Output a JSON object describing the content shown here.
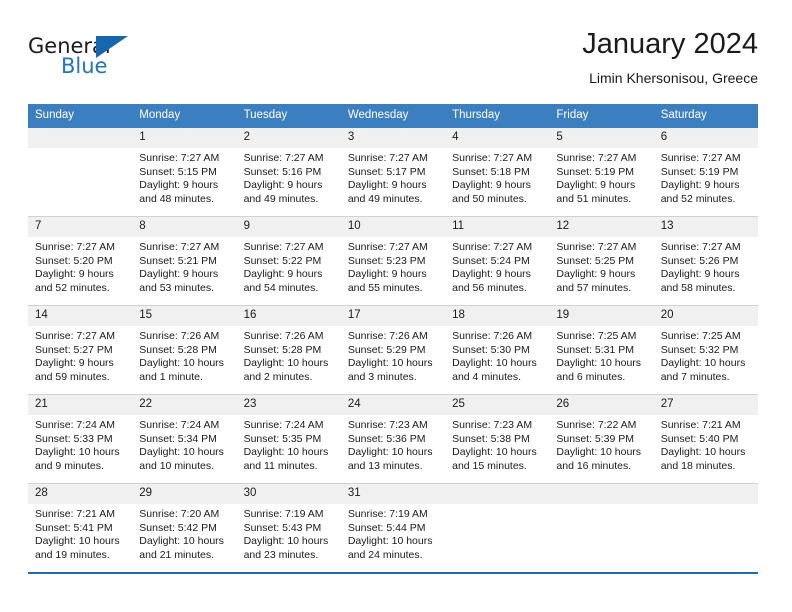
{
  "logo": {
    "word1": "General",
    "word2": "Blue",
    "triangle_color": "#1667ae",
    "blue_text_color": "#2175bc"
  },
  "header": {
    "title": "January 2024",
    "subtitle": "Limin Khersonisou, Greece"
  },
  "calendar": {
    "header_bg": "#3c7fc0",
    "daynum_bg": "#f0f0f0",
    "weekdays": [
      "Sunday",
      "Monday",
      "Tuesday",
      "Wednesday",
      "Thursday",
      "Friday",
      "Saturday"
    ],
    "weeks": [
      [
        {
          "day": "",
          "sunrise": "",
          "sunset": "",
          "daylight": ""
        },
        {
          "day": "1",
          "sunrise": "Sunrise: 7:27 AM",
          "sunset": "Sunset: 5:15 PM",
          "daylight": "Daylight: 9 hours and 48 minutes."
        },
        {
          "day": "2",
          "sunrise": "Sunrise: 7:27 AM",
          "sunset": "Sunset: 5:16 PM",
          "daylight": "Daylight: 9 hours and 49 minutes."
        },
        {
          "day": "3",
          "sunrise": "Sunrise: 7:27 AM",
          "sunset": "Sunset: 5:17 PM",
          "daylight": "Daylight: 9 hours and 49 minutes."
        },
        {
          "day": "4",
          "sunrise": "Sunrise: 7:27 AM",
          "sunset": "Sunset: 5:18 PM",
          "daylight": "Daylight: 9 hours and 50 minutes."
        },
        {
          "day": "5",
          "sunrise": "Sunrise: 7:27 AM",
          "sunset": "Sunset: 5:19 PM",
          "daylight": "Daylight: 9 hours and 51 minutes."
        },
        {
          "day": "6",
          "sunrise": "Sunrise: 7:27 AM",
          "sunset": "Sunset: 5:19 PM",
          "daylight": "Daylight: 9 hours and 52 minutes."
        }
      ],
      [
        {
          "day": "7",
          "sunrise": "Sunrise: 7:27 AM",
          "sunset": "Sunset: 5:20 PM",
          "daylight": "Daylight: 9 hours and 52 minutes."
        },
        {
          "day": "8",
          "sunrise": "Sunrise: 7:27 AM",
          "sunset": "Sunset: 5:21 PM",
          "daylight": "Daylight: 9 hours and 53 minutes."
        },
        {
          "day": "9",
          "sunrise": "Sunrise: 7:27 AM",
          "sunset": "Sunset: 5:22 PM",
          "daylight": "Daylight: 9 hours and 54 minutes."
        },
        {
          "day": "10",
          "sunrise": "Sunrise: 7:27 AM",
          "sunset": "Sunset: 5:23 PM",
          "daylight": "Daylight: 9 hours and 55 minutes."
        },
        {
          "day": "11",
          "sunrise": "Sunrise: 7:27 AM",
          "sunset": "Sunset: 5:24 PM",
          "daylight": "Daylight: 9 hours and 56 minutes."
        },
        {
          "day": "12",
          "sunrise": "Sunrise: 7:27 AM",
          "sunset": "Sunset: 5:25 PM",
          "daylight": "Daylight: 9 hours and 57 minutes."
        },
        {
          "day": "13",
          "sunrise": "Sunrise: 7:27 AM",
          "sunset": "Sunset: 5:26 PM",
          "daylight": "Daylight: 9 hours and 58 minutes."
        }
      ],
      [
        {
          "day": "14",
          "sunrise": "Sunrise: 7:27 AM",
          "sunset": "Sunset: 5:27 PM",
          "daylight": "Daylight: 9 hours and 59 minutes."
        },
        {
          "day": "15",
          "sunrise": "Sunrise: 7:26 AM",
          "sunset": "Sunset: 5:28 PM",
          "daylight": "Daylight: 10 hours and 1 minute."
        },
        {
          "day": "16",
          "sunrise": "Sunrise: 7:26 AM",
          "sunset": "Sunset: 5:28 PM",
          "daylight": "Daylight: 10 hours and 2 minutes."
        },
        {
          "day": "17",
          "sunrise": "Sunrise: 7:26 AM",
          "sunset": "Sunset: 5:29 PM",
          "daylight": "Daylight: 10 hours and 3 minutes."
        },
        {
          "day": "18",
          "sunrise": "Sunrise: 7:26 AM",
          "sunset": "Sunset: 5:30 PM",
          "daylight": "Daylight: 10 hours and 4 minutes."
        },
        {
          "day": "19",
          "sunrise": "Sunrise: 7:25 AM",
          "sunset": "Sunset: 5:31 PM",
          "daylight": "Daylight: 10 hours and 6 minutes."
        },
        {
          "day": "20",
          "sunrise": "Sunrise: 7:25 AM",
          "sunset": "Sunset: 5:32 PM",
          "daylight": "Daylight: 10 hours and 7 minutes."
        }
      ],
      [
        {
          "day": "21",
          "sunrise": "Sunrise: 7:24 AM",
          "sunset": "Sunset: 5:33 PM",
          "daylight": "Daylight: 10 hours and 9 minutes."
        },
        {
          "day": "22",
          "sunrise": "Sunrise: 7:24 AM",
          "sunset": "Sunset: 5:34 PM",
          "daylight": "Daylight: 10 hours and 10 minutes."
        },
        {
          "day": "23",
          "sunrise": "Sunrise: 7:24 AM",
          "sunset": "Sunset: 5:35 PM",
          "daylight": "Daylight: 10 hours and 11 minutes."
        },
        {
          "day": "24",
          "sunrise": "Sunrise: 7:23 AM",
          "sunset": "Sunset: 5:36 PM",
          "daylight": "Daylight: 10 hours and 13 minutes."
        },
        {
          "day": "25",
          "sunrise": "Sunrise: 7:23 AM",
          "sunset": "Sunset: 5:38 PM",
          "daylight": "Daylight: 10 hours and 15 minutes."
        },
        {
          "day": "26",
          "sunrise": "Sunrise: 7:22 AM",
          "sunset": "Sunset: 5:39 PM",
          "daylight": "Daylight: 10 hours and 16 minutes."
        },
        {
          "day": "27",
          "sunrise": "Sunrise: 7:21 AM",
          "sunset": "Sunset: 5:40 PM",
          "daylight": "Daylight: 10 hours and 18 minutes."
        }
      ],
      [
        {
          "day": "28",
          "sunrise": "Sunrise: 7:21 AM",
          "sunset": "Sunset: 5:41 PM",
          "daylight": "Daylight: 10 hours and 19 minutes."
        },
        {
          "day": "29",
          "sunrise": "Sunrise: 7:20 AM",
          "sunset": "Sunset: 5:42 PM",
          "daylight": "Daylight: 10 hours and 21 minutes."
        },
        {
          "day": "30",
          "sunrise": "Sunrise: 7:19 AM",
          "sunset": "Sunset: 5:43 PM",
          "daylight": "Daylight: 10 hours and 23 minutes."
        },
        {
          "day": "31",
          "sunrise": "Sunrise: 7:19 AM",
          "sunset": "Sunset: 5:44 PM",
          "daylight": "Daylight: 10 hours and 24 minutes."
        },
        {
          "day": "",
          "sunrise": "",
          "sunset": "",
          "daylight": ""
        },
        {
          "day": "",
          "sunrise": "",
          "sunset": "",
          "daylight": ""
        },
        {
          "day": "",
          "sunrise": "",
          "sunset": "",
          "daylight": ""
        }
      ]
    ]
  }
}
